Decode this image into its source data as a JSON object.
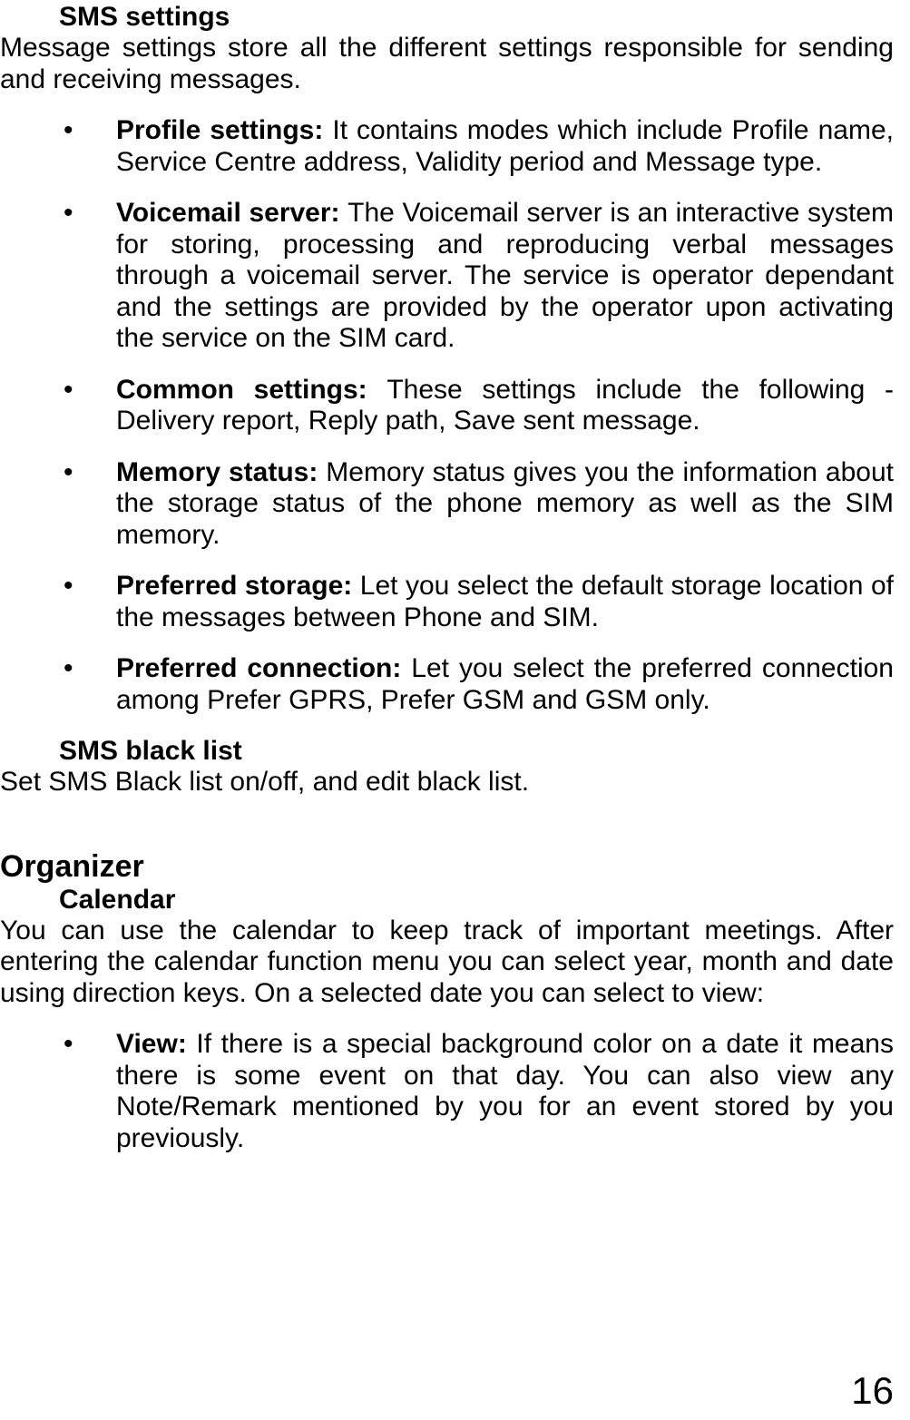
{
  "sms_settings": {
    "heading": "SMS settings",
    "intro": "Message settings store all the different settings responsible for sending and receiving messages.",
    "items": [
      {
        "label": "Profile settings: ",
        "text": "It contains modes which include Profile name, Service Centre address, Validity period and Message type."
      },
      {
        "label": "Voicemail server: ",
        "text": "The Voicemail server is an interactive system for storing, processing and reproducing verbal messages through a voicemail server. The service is operator dependant and the settings are provided by the operator upon activating the service on the SIM card."
      },
      {
        "label": "Common settings: ",
        "text": "These settings include the following - Delivery report, Reply path, Save sent message."
      },
      {
        "label": "Memory status: ",
        "text": "Memory status gives you the information about the storage status of the phone memory as well as the SIM memory."
      },
      {
        "label": "Preferred storage: ",
        "text": "Let you select the default storage location of the messages between Phone and SIM."
      },
      {
        "label": "Preferred connection: ",
        "text": "Let you select the preferred connection among Prefer GPRS, Prefer GSM and GSM only."
      }
    ]
  },
  "sms_blacklist": {
    "heading": "SMS black list",
    "text": "Set SMS Black list on/off, and edit black list."
  },
  "organizer": {
    "heading": "Organizer",
    "calendar": {
      "heading": "Calendar",
      "intro": "You can use the calendar to keep track of important meetings. After entering the calendar function menu you can select year, month and date using direction keys. On a selected date you can select to view:",
      "items": [
        {
          "label": "View: ",
          "text": "If there is a special background color on a date it means there is some event on that day. You can also view any Note/Remark mentioned by you for an event stored by you previously."
        }
      ]
    }
  },
  "page_number": "16"
}
